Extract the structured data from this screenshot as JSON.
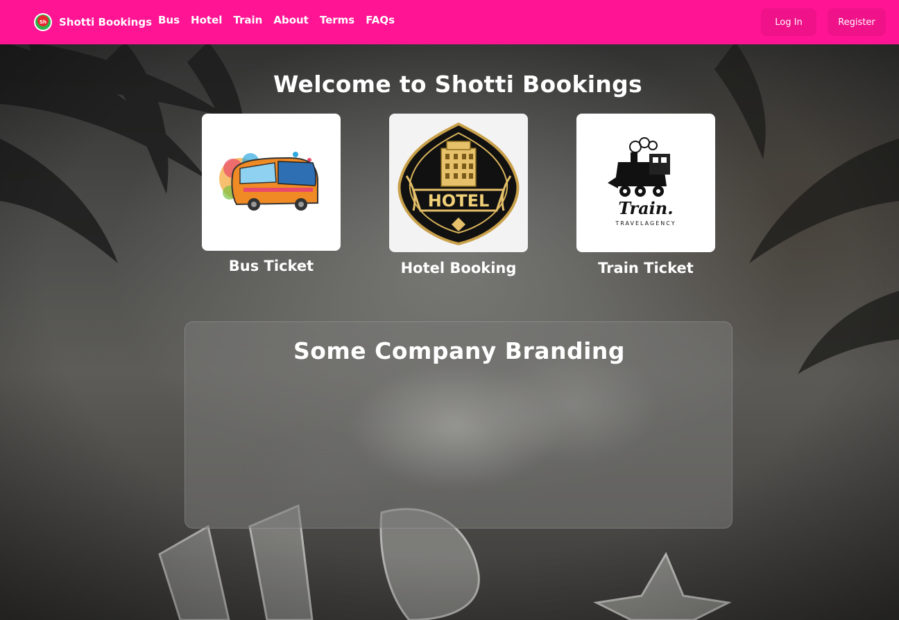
{
  "navbar": {
    "brand_name": "Shotti Bookings",
    "links": [
      "Bus",
      "Hotel",
      "Train",
      "About",
      "Terms",
      "FAQs"
    ],
    "login_label": "Log In",
    "register_label": "Register",
    "colors": {
      "bar": "#ff1493",
      "button": "#ef1288"
    }
  },
  "hero": {
    "title": "Welcome to Shotti Bookings"
  },
  "cards": [
    {
      "label": "Bus Ticket",
      "icon": "bus-illustration"
    },
    {
      "label": "Hotel Booking",
      "icon": "hotel-emblem"
    },
    {
      "label": "Train Ticket",
      "icon": "train-logo"
    }
  ],
  "hotel_emblem_text": "HOTEL",
  "train_logo": {
    "title": "Train.",
    "subtitle": "TRAVELAGENCY"
  },
  "branding": {
    "title": "Some Company Branding"
  }
}
